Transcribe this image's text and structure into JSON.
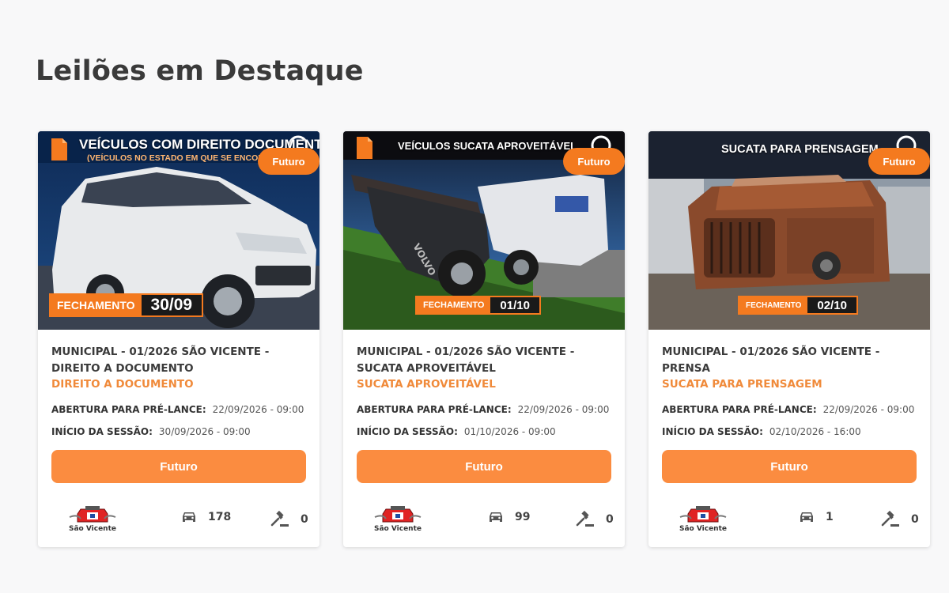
{
  "page": {
    "title": "Leilões em Destaque"
  },
  "cards": [
    {
      "badge": "Futuro",
      "banner": {
        "headline": "VEÍCULOS COM DIREITO DOCUMENTO",
        "subline": "(VEÍCULOS NO ESTADO EM QUE SE ENCONTR/",
        "closing_label": "FECHAMENTO",
        "closing_date": "30/09"
      },
      "title": "MUNICIPAL - 01/2026 SÃO VICENTE - DIREITO A DOCUMENTO",
      "subtitle": "DIREITO A DOCUMENTO",
      "prelance_label": "ABERTURA PARA PRÉ-LANCE:",
      "prelance_value": "22/09/2026 - 09:00",
      "session_label": "INÍCIO DA SESSÃO:",
      "session_value": "30/09/2026 - 09:00",
      "button_label": "Futuro",
      "logo_text": "São Vicente",
      "vehicles": "178",
      "bids": "0"
    },
    {
      "badge": "Futuro",
      "banner": {
        "headline": "VEÍCULOS SUCATA APROVEITÁVEL",
        "subline": "",
        "closing_label": "FECHAMENTO",
        "closing_date": "01/10"
      },
      "title": "MUNICIPAL - 01/2026 SÃO VICENTE - SUCATA APROVEITÁVEL",
      "subtitle": "SUCATA APROVEITÁVEL",
      "prelance_label": "ABERTURA PARA PRÉ-LANCE:",
      "prelance_value": "22/09/2026 - 09:00",
      "session_label": "INÍCIO DA SESSÃO:",
      "session_value": "01/10/2026 - 09:00",
      "button_label": "Futuro",
      "logo_text": "São Vicente",
      "vehicles": "99",
      "bids": "0"
    },
    {
      "badge": "Futuro",
      "banner": {
        "headline": "SUCATA PARA PRENSAGEM",
        "subline": "",
        "closing_label": "FECHAMENTO",
        "closing_date": "02/10"
      },
      "title": "MUNICIPAL - 01/2026 SÃO VICENTE - PRENSA",
      "subtitle": "SUCATA PARA PRENSAGEM",
      "prelance_label": "ABERTURA PARA PRÉ-LANCE:",
      "prelance_value": "22/09/2026 - 09:00",
      "session_label": "INÍCIO DA SESSÃO:",
      "session_value": "02/10/2026 - 16:00",
      "button_label": "Futuro",
      "logo_text": "São Vicente",
      "vehicles": "1",
      "bids": "0"
    }
  ],
  "icons": {
    "vehicles": "car-icon",
    "bids": "gavel-icon",
    "document": "document-icon",
    "brand": "brand-logo-icon"
  },
  "colors": {
    "accent": "#fb8c40",
    "badge": "#f47a1f",
    "subtitle": "#f08a3a"
  }
}
